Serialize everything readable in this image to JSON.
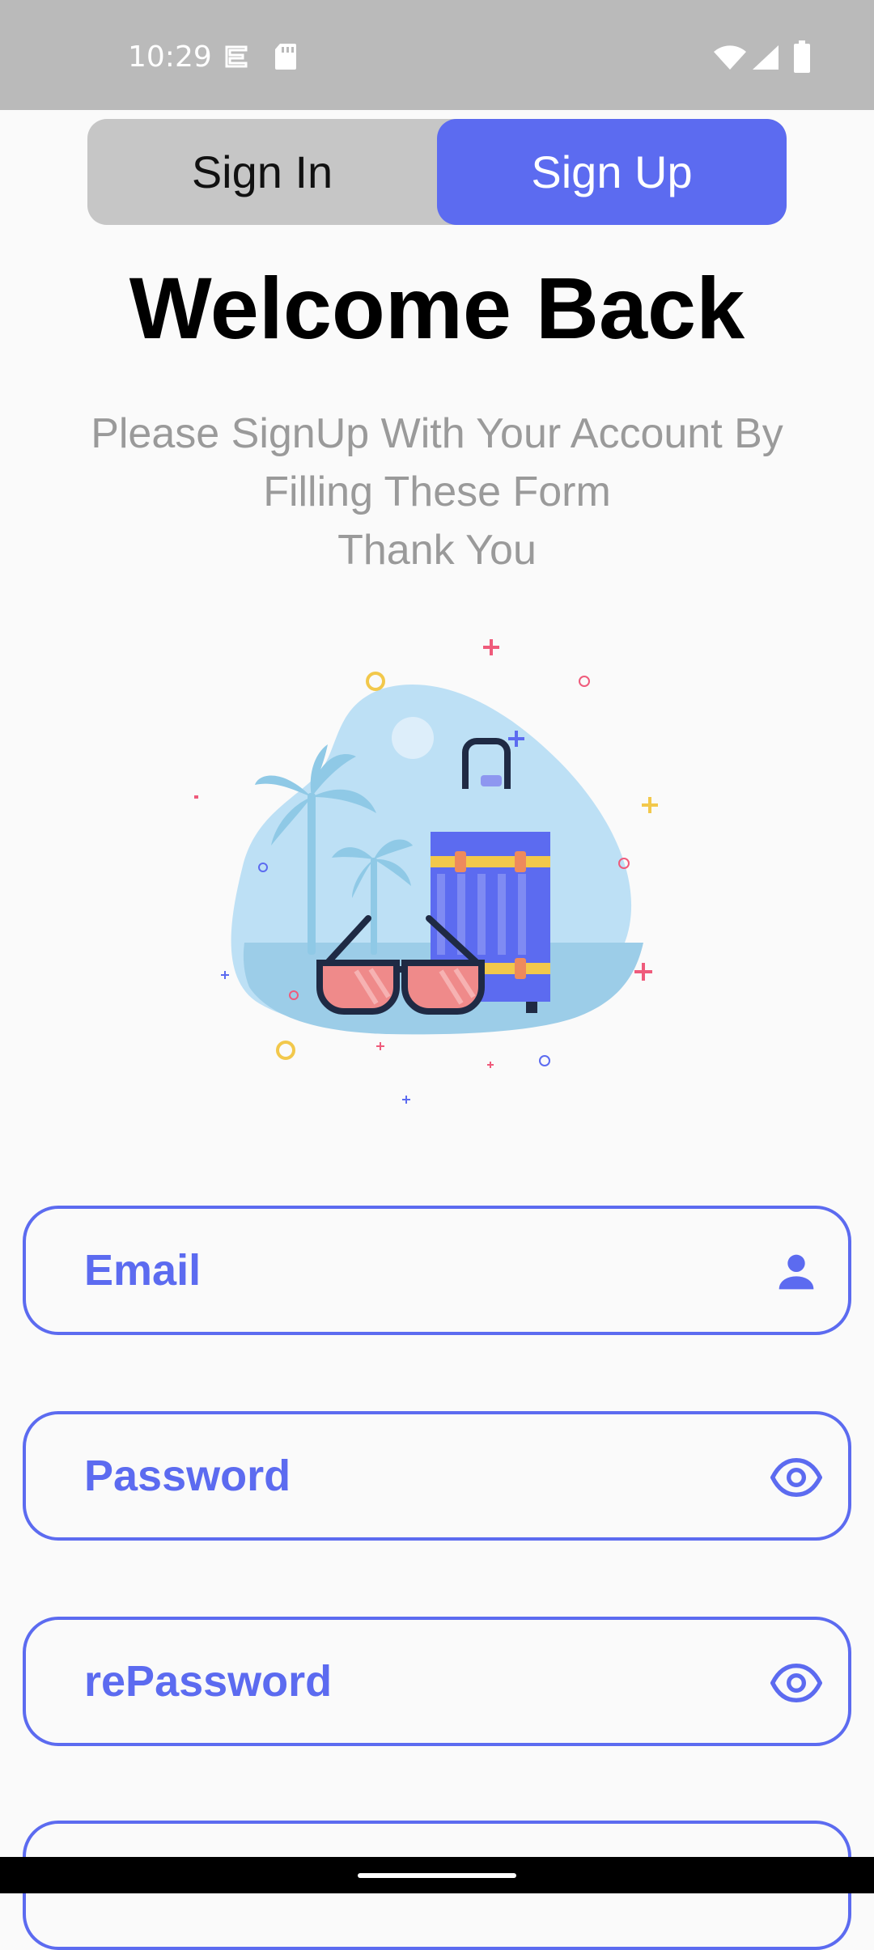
{
  "status_bar": {
    "time": "10:29",
    "icons": [
      "vpn-key-icon",
      "sd-card-icon",
      "wifi-icon",
      "signal-icon",
      "battery-icon"
    ]
  },
  "tabs": {
    "sign_in": "Sign In",
    "sign_up": "Sign Up",
    "active": "sign_up"
  },
  "header": {
    "title": "Welcome Back",
    "subtitle_lines": [
      "Please SignUp With Your Account By",
      "Filling These Form",
      "Thank You"
    ]
  },
  "illustration": {
    "icon": "travel-suitcase-sunglasses-illustration"
  },
  "form": {
    "email": {
      "label": "Email",
      "icon": "person-icon"
    },
    "password": {
      "label": "Password",
      "icon": "eye-icon"
    },
    "repassword": {
      "label": "rePassword",
      "icon": "eye-icon"
    }
  },
  "colors": {
    "accent": "#5c6bf0",
    "status_bar": "#bababa",
    "tab_inactive": "#c6c6c6",
    "subtitle": "#9a9a9a",
    "background": "#fafafa"
  }
}
